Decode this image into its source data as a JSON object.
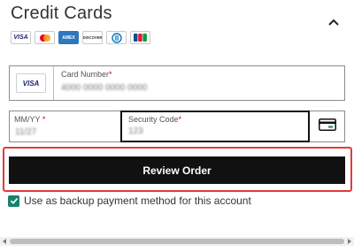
{
  "section": {
    "title": "Credit Cards",
    "collapse_icon": "chevron-up-icon"
  },
  "accepted_cards": [
    {
      "name": "Visa",
      "label": "VISA"
    },
    {
      "name": "Mastercard",
      "label": ""
    },
    {
      "name": "American Express",
      "label": "AMEX"
    },
    {
      "name": "Discover",
      "label": "DISCOVER"
    },
    {
      "name": "Diners Club",
      "label": ""
    },
    {
      "name": "JCB",
      "label": ""
    }
  ],
  "card_number": {
    "label": "Card Number",
    "required_mark": "*",
    "brand": "VISA",
    "value": "4000 0000 0000 0000"
  },
  "expiry": {
    "label": "MM/YY",
    "required_mark": "*",
    "value": "11/27"
  },
  "security_code": {
    "label": "Security Code",
    "required_mark": "*",
    "value": "123",
    "icon": "card-back-icon"
  },
  "review_button": {
    "label": "Review Order"
  },
  "backup_option": {
    "label": "Use as backup payment method for this account",
    "checked": true
  },
  "colors": {
    "accent_green": "#18826d",
    "button_black": "#111111",
    "highlight_red": "#e03b3b"
  }
}
